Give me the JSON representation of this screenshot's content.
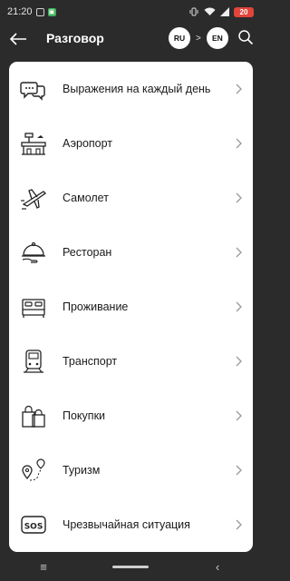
{
  "status_bar": {
    "time": "21:20",
    "battery": "20",
    "icons": [
      "notification-icon",
      "app-icon",
      "vibrate-icon",
      "wifi-icon",
      "signal-icon",
      "battery-icon"
    ]
  },
  "header": {
    "title": "Разговор",
    "source_lang": "RU",
    "target_lang": "EN",
    "lang_arrow": ">"
  },
  "categories": [
    {
      "label": "Выражения на каждый день",
      "icon": "chat-bubbles-icon"
    },
    {
      "label": "Аэропорт",
      "icon": "airport-icon"
    },
    {
      "label": "Самолет",
      "icon": "airplane-icon"
    },
    {
      "label": "Ресторан",
      "icon": "cloche-icon"
    },
    {
      "label": "Проживание",
      "icon": "bed-icon"
    },
    {
      "label": "Транспорт",
      "icon": "train-icon"
    },
    {
      "label": "Покупки",
      "icon": "shopping-bags-icon"
    },
    {
      "label": "Туризм",
      "icon": "map-route-icon"
    },
    {
      "label": "Чрезвычайная ситуация",
      "icon": "sos-icon"
    }
  ],
  "nav": {
    "menu_glyph": "≡",
    "back_glyph": "‹"
  },
  "colors": {
    "background": "#2b2b2b",
    "card": "#ffffff",
    "battery": "#e0443a"
  }
}
